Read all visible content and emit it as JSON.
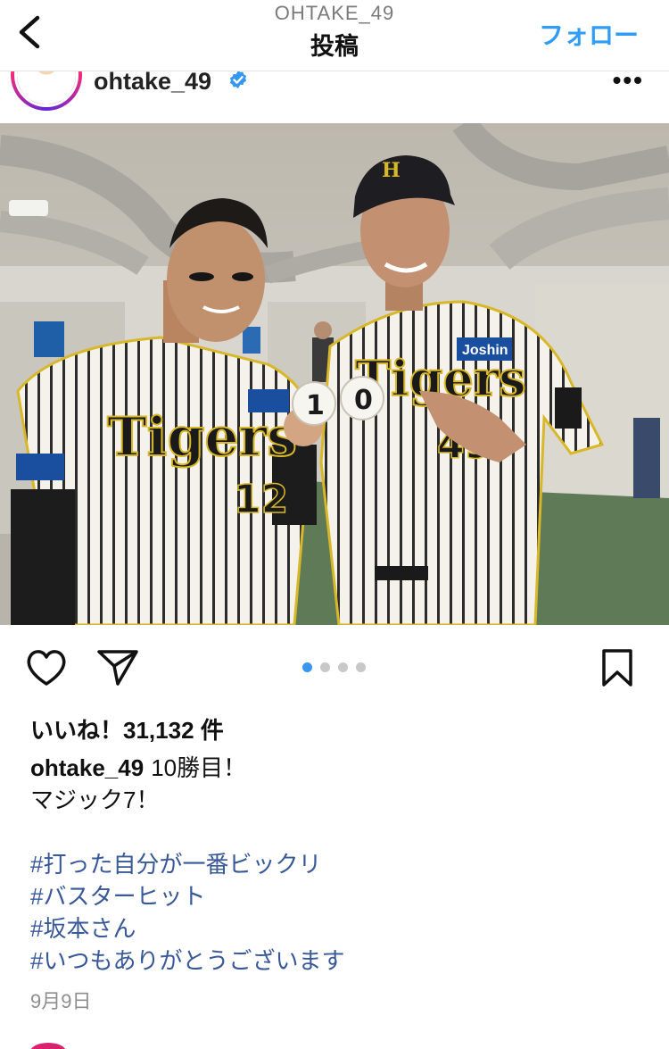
{
  "header": {
    "username": "OHTAKE_49",
    "title": "投稿",
    "follow_label": "フォロー"
  },
  "post": {
    "account": "ohtake_49",
    "photo": {
      "left_jersey_number": "12",
      "right_jersey_number": "49",
      "team_text": "Tigers",
      "sponsor": "Joshin",
      "ball_digits": [
        "1",
        "0"
      ]
    },
    "carousel": {
      "count": 4,
      "active": 1
    },
    "likes": "いいね！31,132 件",
    "caption": {
      "text_line1": "10勝目！",
      "text_line2": "マジック7！",
      "hashtags": [
        "#打った自分が一番ビックリ",
        "#バスターヒット",
        "#坂本さん",
        "#いつもありがとうございます"
      ]
    },
    "date": "9月9日"
  },
  "colors": {
    "accent": "#2f9df5",
    "hashtag": "#385898",
    "dot_active": "#3797f0"
  }
}
